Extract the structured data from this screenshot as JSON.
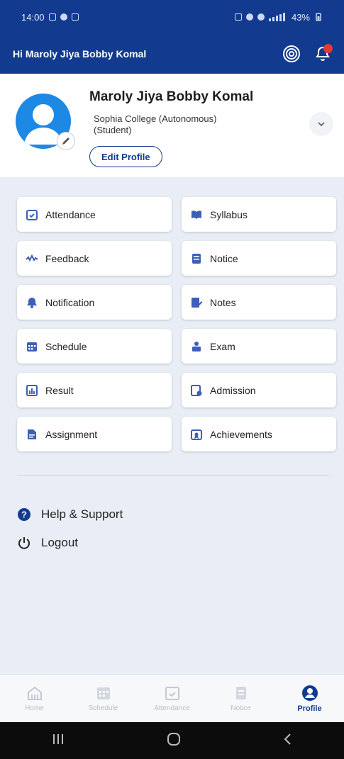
{
  "status_bar": {
    "time": "14:00",
    "battery": "43%"
  },
  "app_bar": {
    "greeting": "Hi Maroly Jiya Bobby Komal",
    "notification_count": ""
  },
  "profile": {
    "name": "Maroly Jiya Bobby Komal",
    "college": "Sophia College (Autonomous)",
    "role": "(Student)",
    "edit_label": "Edit Profile"
  },
  "tiles": [
    {
      "label": "Attendance",
      "icon": "calendar-check-icon"
    },
    {
      "label": "Syllabus",
      "icon": "open-book-icon"
    },
    {
      "label": "Feedback",
      "icon": "feedback-icon"
    },
    {
      "label": "Notice",
      "icon": "notice-icon"
    },
    {
      "label": "Notification",
      "icon": "bell-icon"
    },
    {
      "label": "Notes",
      "icon": "notes-icon"
    },
    {
      "label": "Schedule",
      "icon": "schedule-icon"
    },
    {
      "label": "Exam",
      "icon": "exam-icon"
    },
    {
      "label": "Result",
      "icon": "result-icon"
    },
    {
      "label": "Admission",
      "icon": "admission-icon"
    },
    {
      "label": "Assignment",
      "icon": "assignment-icon"
    },
    {
      "label": "Achievements",
      "icon": "achievement-icon"
    }
  ],
  "menu": {
    "help": "Help & Support",
    "logout": "Logout"
  },
  "bottom_nav": [
    {
      "label": "Home",
      "icon": "home-icon",
      "active": false
    },
    {
      "label": "Schedule",
      "icon": "schedule-icon",
      "active": false
    },
    {
      "label": "Attendance",
      "icon": "calendar-check-icon",
      "active": false
    },
    {
      "label": "Notice",
      "icon": "notice-icon",
      "active": false
    },
    {
      "label": "Profile",
      "icon": "profile-icon",
      "active": true
    }
  ],
  "colors": {
    "primary": "#123a8f",
    "accent_blue": "#3d5fb8",
    "badge_red": "#e53935",
    "avatar_blue": "#1e88e5"
  }
}
